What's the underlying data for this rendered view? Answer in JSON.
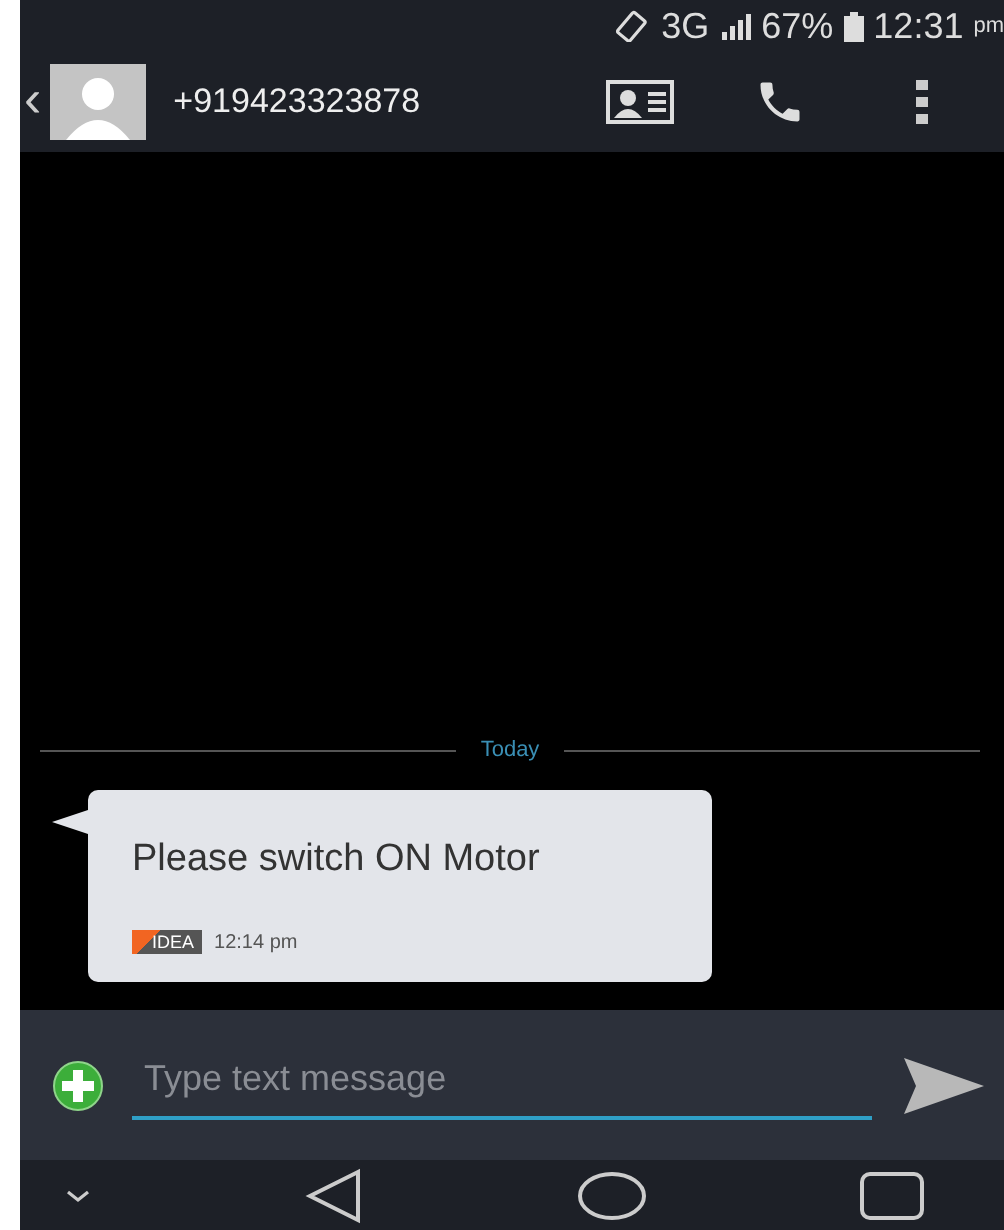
{
  "status_bar": {
    "network": "3G",
    "battery": "67%",
    "time": "12:31",
    "time_suffix": "pm"
  },
  "header": {
    "back": "‹",
    "contact": "+919423323878"
  },
  "date_divider": "Today",
  "messages": [
    {
      "text": "Please switch ON Motor",
      "carrier": "IDEA",
      "time": "12:14 pm",
      "kind": "incoming"
    }
  ],
  "composer": {
    "placeholder": "Type text message"
  }
}
